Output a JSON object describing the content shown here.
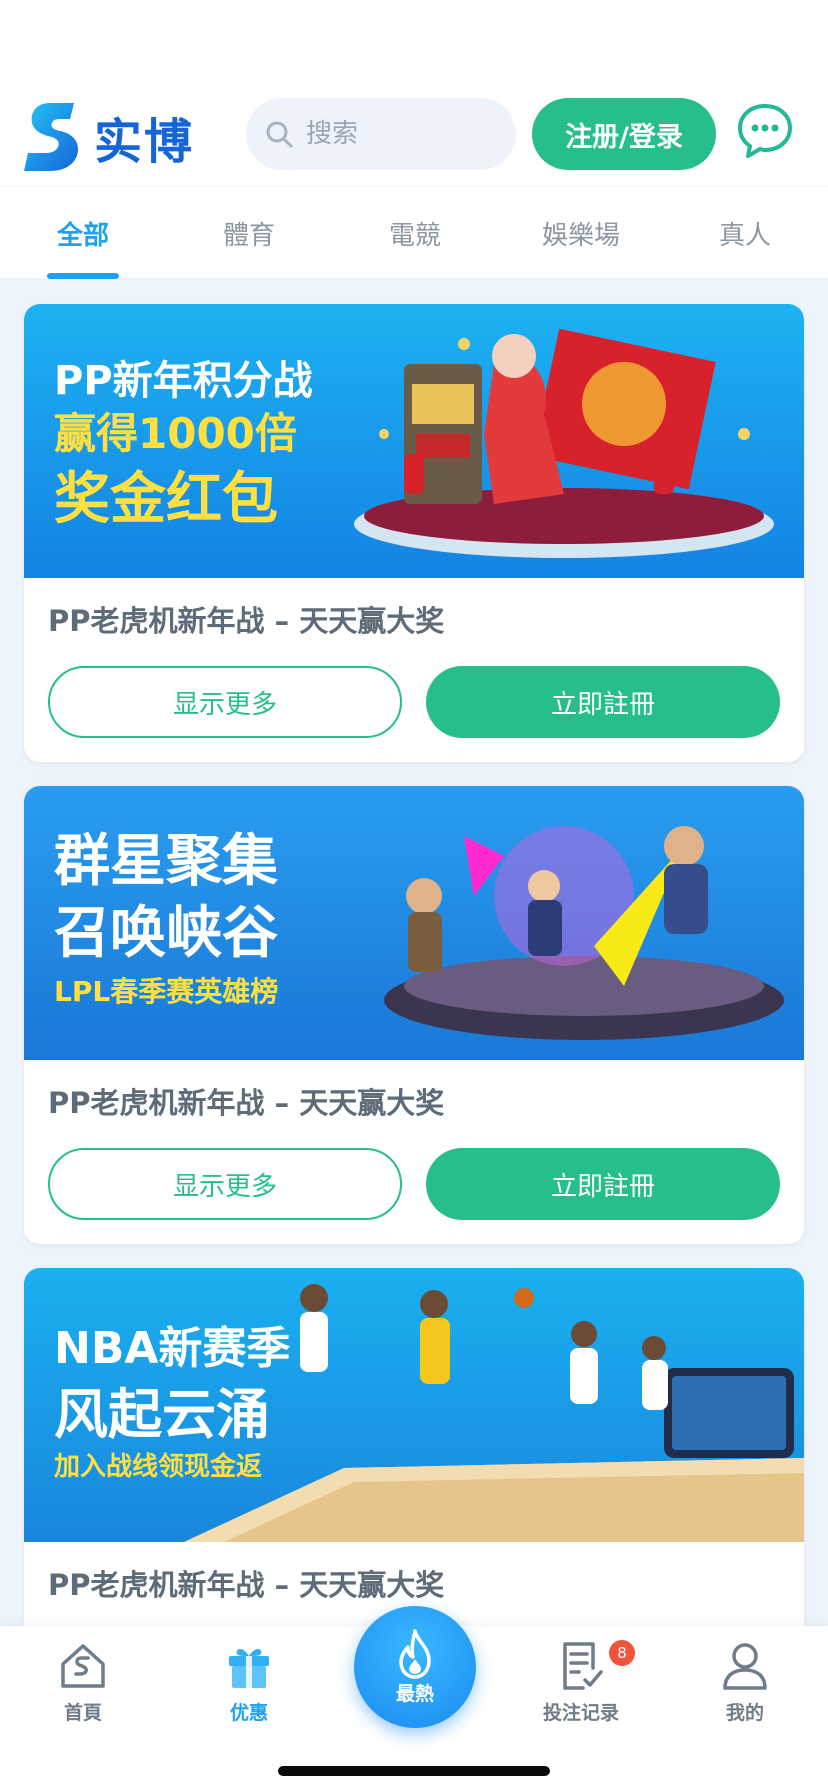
{
  "header": {
    "logo_text": "实博",
    "search_placeholder": "搜索",
    "login_label": "注册/登录"
  },
  "tabs": [
    {
      "label": "全部",
      "active": true
    },
    {
      "label": "體育",
      "active": false
    },
    {
      "label": "電競",
      "active": false
    },
    {
      "label": "娛樂場",
      "active": false
    },
    {
      "label": "真人",
      "active": false
    }
  ],
  "promotions": [
    {
      "banner_lines": [
        "PP新年积分战",
        "赢得1000倍",
        "奖金红包"
      ],
      "title": "PP老虎机新年战 – 天天赢大奖",
      "more_label": "显示更多",
      "register_label": "立即註冊"
    },
    {
      "banner_lines": [
        "群星聚集",
        "召唤峡谷",
        "LPL春季赛英雄榜"
      ],
      "title": "PP老虎机新年战 – 天天赢大奖",
      "more_label": "显示更多",
      "register_label": "立即註冊"
    },
    {
      "banner_lines": [
        "NBA新赛季",
        "风起云涌",
        "加入战线领现金返"
      ],
      "title": "PP老虎机新年战 – 天天赢大奖"
    }
  ],
  "bottom_nav": {
    "items": [
      {
        "label": "首頁",
        "icon": "home-icon"
      },
      {
        "label": "优惠",
        "icon": "gift-icon",
        "active": true
      },
      {
        "label": "最熱",
        "icon": "flame-icon"
      },
      {
        "label": "投注记录",
        "icon": "bet-record-icon",
        "badge": "8"
      },
      {
        "label": "我的",
        "icon": "user-icon"
      }
    ]
  },
  "colors": {
    "brand_blue": "#1565d8",
    "accent_green": "#26bf8c",
    "tab_active": "#1da1f0",
    "badge_red": "#f0553c"
  }
}
